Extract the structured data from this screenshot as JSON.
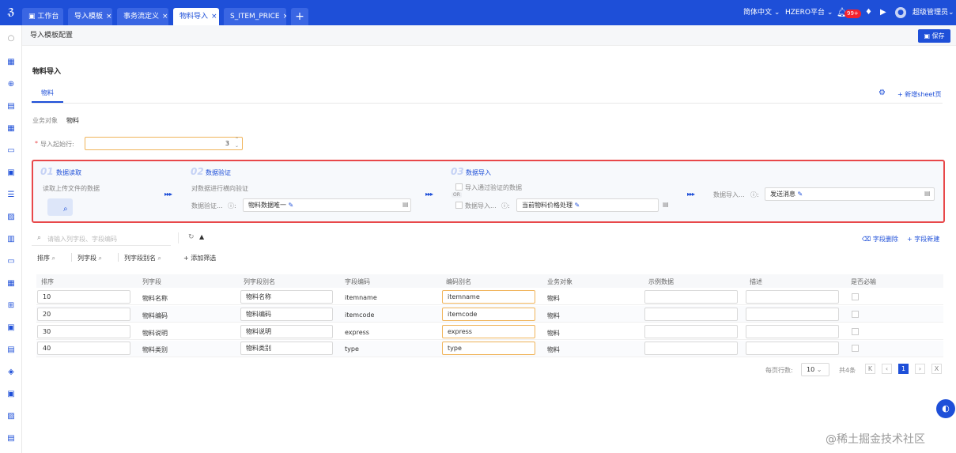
{
  "topbar": {
    "tabs": [
      {
        "label": "工作台",
        "closable": false
      },
      {
        "label": "导入模板",
        "closable": true
      },
      {
        "label": "事务流定义",
        "closable": true
      },
      {
        "label": "物料导入",
        "closable": true,
        "active": true
      },
      {
        "label": "S_ITEM_PRICE",
        "closable": true
      }
    ],
    "close_glyph": "×",
    "add_tab": "+",
    "language": "简体中文",
    "platform": "HZERO平台",
    "badge": "99+",
    "user": "超级管理员",
    "accent": "#1e4fd8"
  },
  "subbar": {
    "title": "导入模板配置",
    "save": "保存"
  },
  "page": {
    "heading": "物料导入",
    "sheet_tab": "物料",
    "add_sheet": "新增sheet页",
    "business_object_label": "业务对象",
    "business_object_value": "物料",
    "start_row_label": "导入起始行:",
    "required_mark": "*",
    "start_row_value": "3"
  },
  "steps": [
    {
      "num": "01",
      "title": "数据读取",
      "desc": "读取上传文件的数据"
    },
    {
      "num": "02",
      "title": "数据验证",
      "desc": "对数据进行横向验证",
      "field_label": "数据验证...",
      "field_value": "物料数据唯一"
    },
    {
      "num": "03",
      "title": "数据导入",
      "checkbox_label": "导入通过验证的数据",
      "or_label": "OR",
      "field_label": "数据导入...",
      "field_value": "当前物料价格处理"
    },
    {
      "field_label": "数据导入...",
      "field_value": "发送消息"
    }
  ],
  "toolbar": {
    "search_placeholder": "请输入列字段、字段编码",
    "delete": "字段删除",
    "add": "字段新建",
    "filters": [
      "排序",
      "列字段",
      "列字段别名"
    ],
    "add_filter": "添加筛选"
  },
  "table": {
    "headers": [
      "排序",
      "列字段",
      "列字段别名",
      "字段编码",
      "编码别名",
      "业务对象",
      "示例数据",
      "描述",
      "是否必输"
    ],
    "rows": [
      {
        "order": "10",
        "field": "物料名称",
        "alias": "物料名称",
        "code": "itemname",
        "code_alias": "itemname",
        "object": "物料"
      },
      {
        "order": "20",
        "field": "物料编码",
        "alias": "物料编码",
        "code": "itemcode",
        "code_alias": "itemcode",
        "object": "物料"
      },
      {
        "order": "30",
        "field": "物料说明",
        "alias": "物料说明",
        "code": "express",
        "code_alias": "express",
        "object": "物料"
      },
      {
        "order": "40",
        "field": "物料类别",
        "alias": "物料类别",
        "code": "type",
        "code_alias": "type",
        "object": "物料"
      }
    ]
  },
  "pagination": {
    "page_size_label": "每页行数:",
    "page_size": "10",
    "total": "共4条",
    "current": "1"
  },
  "watermark": "@稀土掘金技术社区"
}
